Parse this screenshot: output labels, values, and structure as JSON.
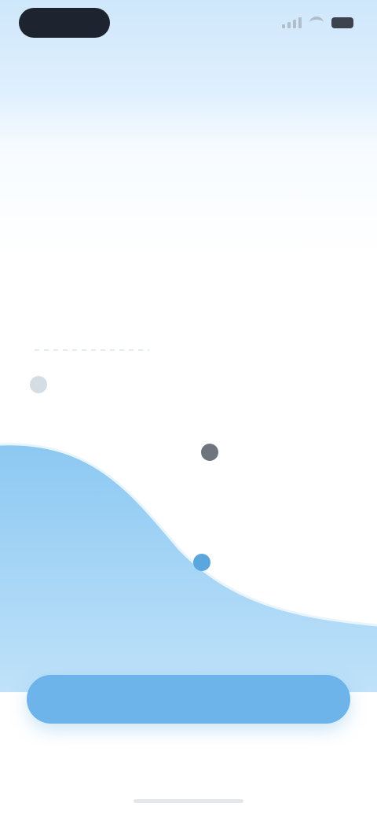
{
  "status_bar": {
    "icons": [
      "cellular-signal-icon",
      "wifi-icon",
      "battery-icon"
    ]
  },
  "header": {
    "title": ""
  },
  "article": {
    "lead_part1": "",
    "lead_accent": "",
    "lead_part2": "",
    "subline": ""
  },
  "chart": {
    "top_label": "",
    "marker_start": {
      "label": "",
      "color": "#d5dde4"
    },
    "marker_mid": {
      "label": "",
      "color": "#6e757c"
    },
    "marker_end": {
      "label": "",
      "color": "#5aa7df"
    },
    "fill_colors": [
      "#8cc8f2",
      "#bfe2f9"
    ]
  },
  "caption": "",
  "cta": {
    "label": "",
    "color": "#6cb4e9"
  },
  "colors": {
    "accent": "#5b8fc2",
    "brand": "#6cb4e9"
  }
}
